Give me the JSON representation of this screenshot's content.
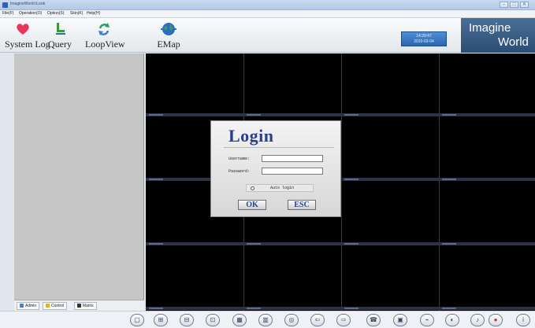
{
  "window": {
    "title": "ImagineWorld iLook",
    "controls": [
      "–",
      "□",
      "✕"
    ]
  },
  "menu": [
    "File(F)",
    "Operation(O)",
    "Option(S)",
    "Skin(K)",
    "Help(H)"
  ],
  "toolbar": {
    "items": [
      {
        "label": "System Log",
        "icon": "heart-icon"
      },
      {
        "label": "Query",
        "icon": "chair-icon"
      },
      {
        "label": "LoopView",
        "icon": "loop-arrows-icon"
      },
      {
        "label": "EMap",
        "icon": "globe-icon"
      }
    ],
    "time": "14:29:47",
    "date": "2010-03-04",
    "brand_line1": "Imagine",
    "brand_line2": "World",
    "brand_colors": {
      "primary": "#2c4d73",
      "datetime": "#2a66b3"
    }
  },
  "left_tabs": [
    {
      "label": "Admin",
      "icon": "admin-icon"
    },
    {
      "label": "Control",
      "icon": "control-icon"
    },
    {
      "label": "Matrix",
      "icon": "matrix-icon"
    }
  ],
  "login": {
    "title": "Login",
    "username_label": "Username:",
    "password_label": "Password:",
    "username_value": "",
    "password_value": "",
    "auto_login_label": "Auto login",
    "auto_login_checked": false,
    "ok_label": "OK",
    "esc_label": "ESC"
  },
  "bottom_controls": [
    {
      "name": "layout-1-icon",
      "glyph": "▢"
    },
    {
      "name": "layout-4-icon",
      "glyph": "⊞"
    },
    {
      "name": "layout-6-icon",
      "glyph": "⊟"
    },
    {
      "name": "layout-8-icon",
      "glyph": "⊡"
    },
    {
      "name": "layout-9-icon",
      "glyph": "▦"
    },
    {
      "name": "layout-16-icon",
      "glyph": "▥"
    },
    {
      "name": "fullscreen-icon",
      "glyph": "◎"
    },
    {
      "name": "previous-icon",
      "glyph": "⇦"
    },
    {
      "name": "next-icon",
      "glyph": "⇨"
    },
    {
      "name": "phone-icon",
      "glyph": "☎"
    },
    {
      "name": "snapshot-icon",
      "glyph": "▣"
    },
    {
      "name": "talk-icon",
      "glyph": "⌁"
    },
    {
      "name": "volume-icon",
      "glyph": "◐"
    },
    {
      "name": "speaker-icon",
      "glyph": "♪"
    },
    {
      "name": "record-icon",
      "glyph": "●"
    },
    {
      "name": "info-icon",
      "glyph": "i"
    }
  ]
}
